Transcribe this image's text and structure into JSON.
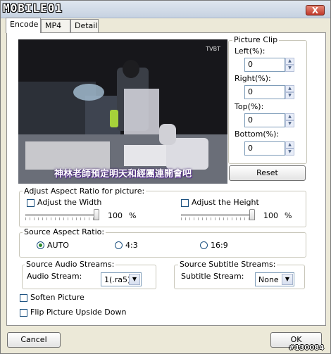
{
  "titlebar": {
    "logo_text": "MOBILE01",
    "close_label": "X"
  },
  "tabs": [
    {
      "label": "Encode"
    },
    {
      "label": "MP4"
    },
    {
      "label": "Detail"
    }
  ],
  "preview": {
    "subtitle": "神林老師預定明天和經團連開會吧",
    "channel": "TVBT"
  },
  "picture_clip": {
    "title": "Picture Clip",
    "left_label": "Left(%):",
    "left_value": "0",
    "right_label": "Right(%):",
    "right_value": "0",
    "top_label": "Top(%):",
    "top_value": "0",
    "bottom_label": "Bottom(%):",
    "bottom_value": "0",
    "reset_label": "Reset"
  },
  "aspect_adjust": {
    "title": "Adjust Aspect Ratio for picture:",
    "width_label": "Adjust the Width",
    "width_value": "100",
    "width_unit": "%",
    "width_level": 100,
    "height_label": "Adjust the Height",
    "height_value": "100",
    "height_unit": "%",
    "height_level": 100
  },
  "source_aspect": {
    "title": "Source Aspect Ratio:",
    "options": [
      "AUTO",
      "4:3",
      "16:9"
    ],
    "selected": "AUTO"
  },
  "audio": {
    "title": "Source Audio Streams:",
    "label": "Audio Stream:",
    "value": "1(.ra5)"
  },
  "subtitle_streams": {
    "title": "Source Subtitle Streams:",
    "label": "Subtitle Stream:",
    "value": "None"
  },
  "options": {
    "soften_label": "Soften Picture",
    "flip_label": "Flip Picture Upside Down"
  },
  "footer": {
    "cancel_label": "Cancel",
    "ok_label": "OK",
    "watermark": "#130084"
  },
  "icons": {
    "spin_up": "▲",
    "spin_down": "▼",
    "dropdown": "▼"
  }
}
